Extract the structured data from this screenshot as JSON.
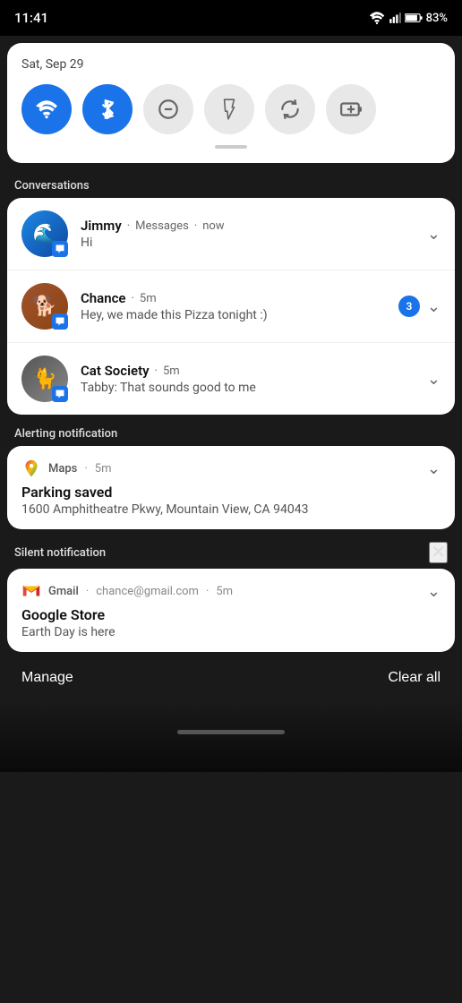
{
  "statusBar": {
    "time": "11:41",
    "battery": "83%"
  },
  "quickSettings": {
    "date": "Sat, Sep 29",
    "buttons": [
      {
        "id": "wifi",
        "label": "WiFi",
        "active": true
      },
      {
        "id": "bluetooth",
        "label": "Bluetooth",
        "active": true
      },
      {
        "id": "dnd",
        "label": "Do Not Disturb",
        "active": false
      },
      {
        "id": "flashlight",
        "label": "Flashlight",
        "active": false
      },
      {
        "id": "rotate",
        "label": "Auto-rotate",
        "active": false
      },
      {
        "id": "battery",
        "label": "Battery Saver",
        "active": false
      }
    ]
  },
  "sections": {
    "conversations": "Conversations",
    "alerting": "Alerting notification",
    "silent": "Silent notification"
  },
  "conversations": [
    {
      "name": "Jimmy",
      "app": "Messages",
      "time": "now",
      "message": "Hi",
      "unread": 0,
      "avatarType": "jimmy"
    },
    {
      "name": "Chance",
      "app": "",
      "time": "5m",
      "message": "Hey, we made this Pizza tonight :)",
      "unread": 3,
      "avatarType": "chance"
    },
    {
      "name": "Cat Society",
      "app": "",
      "time": "5m",
      "message": "Tabby: That sounds good to me",
      "unread": 0,
      "avatarType": "cat"
    }
  ],
  "mapsNotif": {
    "app": "Maps",
    "time": "5m",
    "title": "Parking saved",
    "body": "1600 Amphitheatre Pkwy, Mountain View, CA 94043"
  },
  "gmailNotif": {
    "app": "Gmail",
    "email": "chance@gmail.com",
    "time": "5m",
    "title": "Google Store",
    "body": "Earth Day is here"
  },
  "bottomBar": {
    "manage": "Manage",
    "clearAll": "Clear all"
  }
}
